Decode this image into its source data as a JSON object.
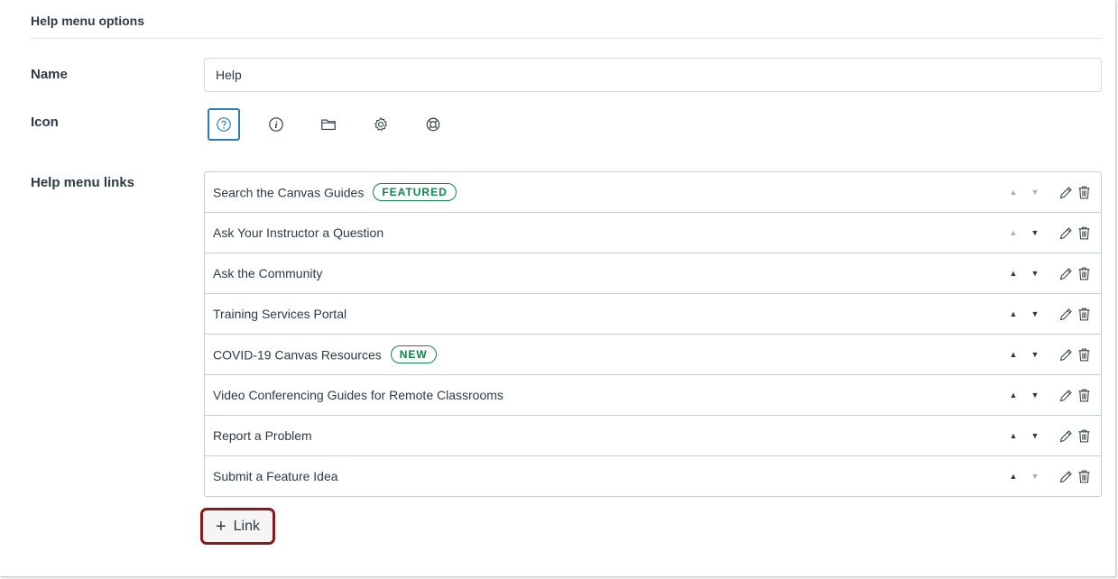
{
  "section": {
    "title": "Help menu options"
  },
  "form": {
    "name_label": "Name",
    "name_value": "Help",
    "icon_label": "Icon",
    "links_label": "Help menu links"
  },
  "icons": [
    {
      "name": "question-icon",
      "selected": true
    },
    {
      "name": "info-icon",
      "selected": false
    },
    {
      "name": "folder-icon",
      "selected": false
    },
    {
      "name": "gear-icon",
      "selected": false
    },
    {
      "name": "lifebuoy-icon",
      "selected": false
    }
  ],
  "links": [
    {
      "label": "Search the Canvas Guides",
      "badge": "FEATURED",
      "up_enabled": false,
      "down_enabled": false
    },
    {
      "label": "Ask Your Instructor a Question",
      "badge": "",
      "up_enabled": false,
      "down_enabled": true
    },
    {
      "label": "Ask the Community",
      "badge": "",
      "up_enabled": true,
      "down_enabled": true
    },
    {
      "label": "Training Services Portal",
      "badge": "",
      "up_enabled": true,
      "down_enabled": true
    },
    {
      "label": "COVID-19 Canvas Resources",
      "badge": "NEW",
      "up_enabled": true,
      "down_enabled": true
    },
    {
      "label": "Video Conferencing Guides for Remote Classrooms",
      "badge": "",
      "up_enabled": true,
      "down_enabled": true
    },
    {
      "label": "Report a Problem",
      "badge": "",
      "up_enabled": true,
      "down_enabled": true
    },
    {
      "label": "Submit a Feature Idea",
      "badge": "",
      "up_enabled": true,
      "down_enabled": false
    }
  ],
  "add_link": {
    "label": "Link"
  },
  "colors": {
    "text": "#2d3b45",
    "badge_green": "#0b874b",
    "selected_blue": "#2b7abc",
    "highlight_red": "#8b1a1a",
    "border": "#c7cdd1"
  }
}
